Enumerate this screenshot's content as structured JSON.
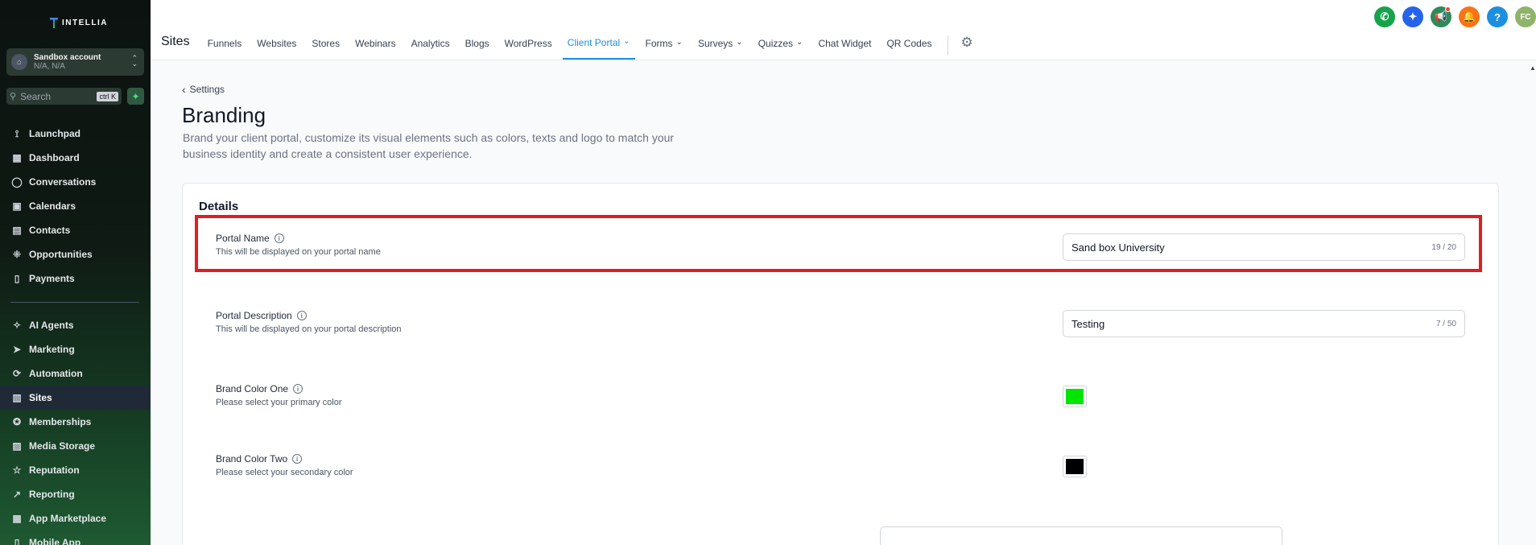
{
  "brand": {
    "name": "INTELLIA"
  },
  "account": {
    "name": "Sandbox account",
    "location": "N/A, N/A"
  },
  "search": {
    "placeholder": "Search",
    "shortcut": "ctrl K"
  },
  "sidebar": {
    "items": [
      {
        "label": "Launchpad",
        "icon": "rocket-icon"
      },
      {
        "label": "Dashboard",
        "icon": "grid-icon"
      },
      {
        "label": "Conversations",
        "icon": "chat-icon"
      },
      {
        "label": "Calendars",
        "icon": "calendar-icon"
      },
      {
        "label": "Contacts",
        "icon": "contacts-icon"
      },
      {
        "label": "Opportunities",
        "icon": "pipeline-icon"
      },
      {
        "label": "Payments",
        "icon": "receipt-icon"
      }
    ],
    "items2": [
      {
        "label": "AI Agents",
        "icon": "sparkle-icon"
      },
      {
        "label": "Marketing",
        "icon": "send-icon"
      },
      {
        "label": "Automation",
        "icon": "automation-icon"
      },
      {
        "label": "Sites",
        "icon": "sites-icon",
        "active": true
      },
      {
        "label": "Memberships",
        "icon": "badge-icon"
      },
      {
        "label": "Media Storage",
        "icon": "image-icon"
      },
      {
        "label": "Reputation",
        "icon": "star-icon"
      },
      {
        "label": "Reporting",
        "icon": "chart-icon"
      },
      {
        "label": "App Marketplace",
        "icon": "apps-icon"
      },
      {
        "label": "Mobile App",
        "icon": "phone-icon"
      }
    ]
  },
  "header": {
    "section_title": "Sites",
    "tabs": [
      {
        "label": "Funnels"
      },
      {
        "label": "Websites"
      },
      {
        "label": "Stores"
      },
      {
        "label": "Webinars"
      },
      {
        "label": "Analytics"
      },
      {
        "label": "Blogs"
      },
      {
        "label": "WordPress"
      },
      {
        "label": "Client Portal",
        "active": true,
        "dropdown": true
      },
      {
        "label": "Forms",
        "dropdown": true
      },
      {
        "label": "Surveys",
        "dropdown": true
      },
      {
        "label": "Quizzes",
        "dropdown": true
      },
      {
        "label": "Chat Widget"
      },
      {
        "label": "QR Codes"
      }
    ],
    "top_icons": [
      {
        "name": "phone-icon",
        "color": "#16a34a",
        "glyph": "✆"
      },
      {
        "name": "magic-icon",
        "color": "#2563eb",
        "glyph": "✦"
      },
      {
        "name": "megaphone-icon",
        "color": "#2f8a5a",
        "glyph": "📢",
        "dot": true
      },
      {
        "name": "bell-icon",
        "color": "#f97316",
        "glyph": "🔔"
      },
      {
        "name": "help-icon",
        "color": "#1d8fe0",
        "glyph": "?"
      },
      {
        "name": "user-avatar",
        "color": "#8fb36a",
        "glyph": "FC"
      }
    ]
  },
  "page": {
    "back_label": "Settings",
    "title": "Branding",
    "description": "Brand your client portal, customize its visual elements such as colors, texts and logo to match your business identity and create a consistent user experience."
  },
  "details": {
    "title": "Details",
    "portal_name": {
      "label": "Portal Name",
      "sub": "This will be displayed on your portal name",
      "value": "Sand box University",
      "counter": "19 / 20"
    },
    "portal_description": {
      "label": "Portal Description",
      "sub": "This will be displayed on your portal description",
      "value": "Testing",
      "counter": "7 / 50"
    },
    "brand_color_one": {
      "label": "Brand Color One",
      "sub": "Please select your primary color",
      "color": "#00e600"
    },
    "brand_color_two": {
      "label": "Brand Color Two",
      "sub": "Please select your secondary color",
      "color": "#000000"
    }
  }
}
